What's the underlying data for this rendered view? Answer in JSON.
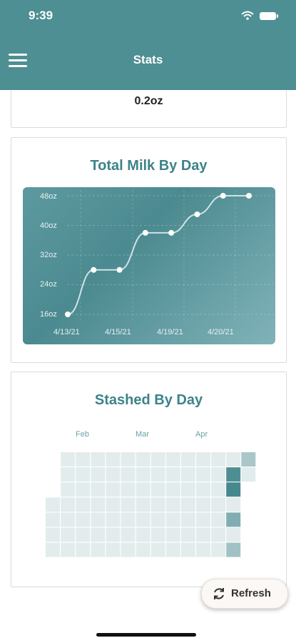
{
  "status_bar": {
    "time": "9:39"
  },
  "header": {
    "title": "Stats"
  },
  "partial_card": {
    "value": "0.2oz"
  },
  "total_milk": {
    "title": "Total Milk By Day",
    "y_ticks": [
      "48oz",
      "40oz",
      "32oz",
      "24oz",
      "16oz"
    ],
    "x_ticks": [
      "4/13/21",
      "4/15/21",
      "4/19/21",
      "4/20/21"
    ]
  },
  "stashed": {
    "title": "Stashed By Day",
    "months": [
      "Feb",
      "Mar",
      "Apr"
    ]
  },
  "refresh": {
    "label": "Refresh",
    "icon": "refresh-icon"
  },
  "colors": {
    "header": "#4d8f92",
    "accent": "#3d8389",
    "heat_empty": "#e3ecec"
  },
  "chart_data": [
    {
      "type": "line",
      "title": "Total Milk By Day",
      "y_unit": "oz",
      "ylim": [
        14,
        50
      ],
      "yticks": [
        16,
        24,
        32,
        40,
        48
      ],
      "x": [
        0,
        1,
        2,
        3,
        4,
        5,
        6,
        7
      ],
      "values": [
        16,
        28,
        28,
        38,
        38,
        43,
        48,
        48
      ],
      "x_tick_labels": [
        "4/13/21",
        "4/15/21",
        "4/19/21",
        "4/20/21"
      ],
      "grid": true,
      "curve": "smooth"
    },
    {
      "type": "heatmap",
      "title": "Stashed By Day",
      "months": [
        "Feb",
        "Mar",
        "Apr"
      ],
      "columns": 14,
      "rows": 7,
      "filled": [
        {
          "col": 12,
          "row": 1,
          "level": 0.9
        },
        {
          "col": 12,
          "row": 2,
          "level": 0.95
        },
        {
          "col": 12,
          "row": 4,
          "level": 0.6
        },
        {
          "col": 12,
          "row": 6,
          "level": 0.4
        },
        {
          "col": 13,
          "row": 0,
          "level": 0.35
        }
      ]
    }
  ]
}
